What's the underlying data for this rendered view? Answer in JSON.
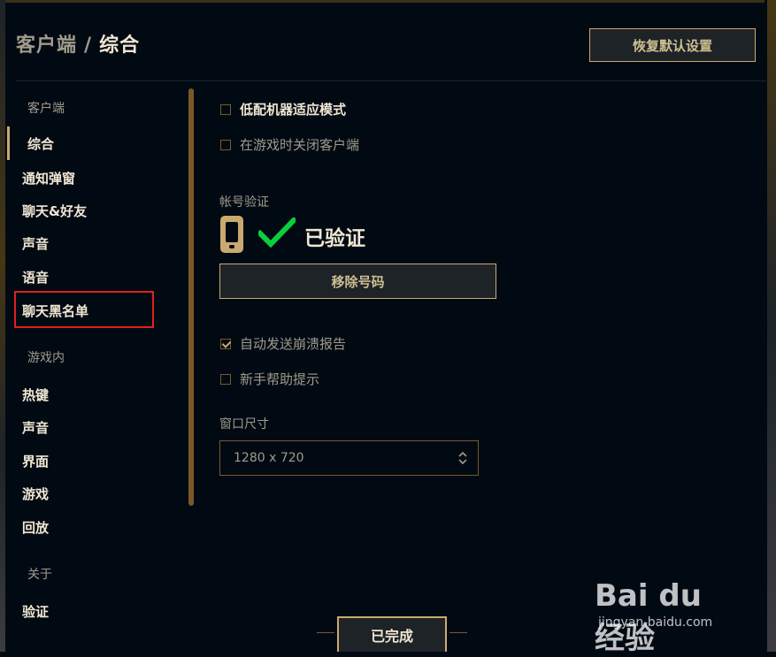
{
  "header": {
    "breadcrumb": "客户端",
    "separator": "/",
    "current": "综合",
    "reset_button": "恢复默认设置"
  },
  "sidebar": {
    "sections": [
      {
        "heading": "客户端",
        "items": [
          "综合",
          "通知弹窗",
          "聊天&好友",
          "声音",
          "语音",
          "聊天黑名单"
        ]
      },
      {
        "heading": "游戏内",
        "items": [
          "热键",
          "声音",
          "界面",
          "游戏",
          "回放"
        ]
      },
      {
        "heading": "关于",
        "items": [
          "验证"
        ]
      }
    ],
    "active_item": "综合",
    "highlighted_item": "聊天黑名单"
  },
  "main": {
    "low_spec_mode": {
      "label": "低配机器适应模式",
      "checked": false
    },
    "close_client_in_game": {
      "label": "在游戏时关闭客户端",
      "checked": false
    },
    "account_verify": {
      "label": "帐号验证",
      "status": "已验证",
      "remove_button": "移除号码"
    },
    "auto_crash_report": {
      "label": "自动发送崩溃报告",
      "checked": true
    },
    "new_player_tips": {
      "label": "新手帮助提示",
      "checked": false
    },
    "window_size": {
      "label": "窗口尺寸",
      "value": "1280 x 720"
    }
  },
  "footer": {
    "done_button": "已完成"
  },
  "watermark": {
    "logo": "Bai du 经验",
    "url": "jingyan.baidu.com"
  },
  "colors": {
    "background": "#010a13",
    "gold": "#c8aa6e",
    "gold_dark": "#785a28",
    "text_light": "#f0e6d2",
    "text_dim": "#a09b8c",
    "verified_green": "#0acf3c",
    "highlight_red": "#e02020"
  },
  "icons": {
    "phone": "phone-icon",
    "check": "check-icon",
    "select_arrows": "select-arrows-icon",
    "checkbox": "checkbox-icon"
  }
}
